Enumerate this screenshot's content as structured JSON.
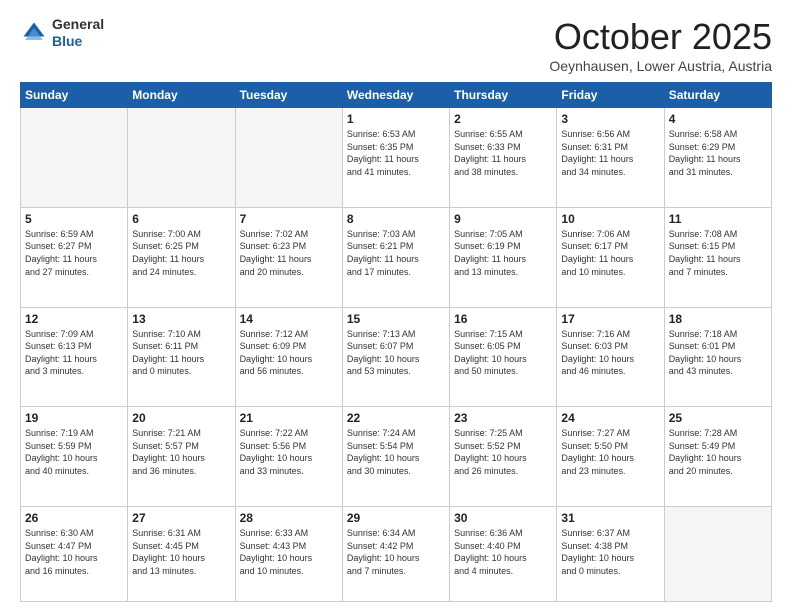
{
  "logo": {
    "line1": "General",
    "line2": "Blue"
  },
  "header": {
    "title": "October 2025",
    "subtitle": "Oeynhausen, Lower Austria, Austria"
  },
  "weekdays": [
    "Sunday",
    "Monday",
    "Tuesday",
    "Wednesday",
    "Thursday",
    "Friday",
    "Saturday"
  ],
  "weeks": [
    [
      {
        "day": "",
        "info": "",
        "empty": true
      },
      {
        "day": "",
        "info": "",
        "empty": true
      },
      {
        "day": "",
        "info": "",
        "empty": true
      },
      {
        "day": "1",
        "info": "Sunrise: 6:53 AM\nSunset: 6:35 PM\nDaylight: 11 hours\nand 41 minutes."
      },
      {
        "day": "2",
        "info": "Sunrise: 6:55 AM\nSunset: 6:33 PM\nDaylight: 11 hours\nand 38 minutes."
      },
      {
        "day": "3",
        "info": "Sunrise: 6:56 AM\nSunset: 6:31 PM\nDaylight: 11 hours\nand 34 minutes."
      },
      {
        "day": "4",
        "info": "Sunrise: 6:58 AM\nSunset: 6:29 PM\nDaylight: 11 hours\nand 31 minutes."
      }
    ],
    [
      {
        "day": "5",
        "info": "Sunrise: 6:59 AM\nSunset: 6:27 PM\nDaylight: 11 hours\nand 27 minutes."
      },
      {
        "day": "6",
        "info": "Sunrise: 7:00 AM\nSunset: 6:25 PM\nDaylight: 11 hours\nand 24 minutes."
      },
      {
        "day": "7",
        "info": "Sunrise: 7:02 AM\nSunset: 6:23 PM\nDaylight: 11 hours\nand 20 minutes."
      },
      {
        "day": "8",
        "info": "Sunrise: 7:03 AM\nSunset: 6:21 PM\nDaylight: 11 hours\nand 17 minutes."
      },
      {
        "day": "9",
        "info": "Sunrise: 7:05 AM\nSunset: 6:19 PM\nDaylight: 11 hours\nand 13 minutes."
      },
      {
        "day": "10",
        "info": "Sunrise: 7:06 AM\nSunset: 6:17 PM\nDaylight: 11 hours\nand 10 minutes."
      },
      {
        "day": "11",
        "info": "Sunrise: 7:08 AM\nSunset: 6:15 PM\nDaylight: 11 hours\nand 7 minutes."
      }
    ],
    [
      {
        "day": "12",
        "info": "Sunrise: 7:09 AM\nSunset: 6:13 PM\nDaylight: 11 hours\nand 3 minutes."
      },
      {
        "day": "13",
        "info": "Sunrise: 7:10 AM\nSunset: 6:11 PM\nDaylight: 11 hours\nand 0 minutes."
      },
      {
        "day": "14",
        "info": "Sunrise: 7:12 AM\nSunset: 6:09 PM\nDaylight: 10 hours\nand 56 minutes."
      },
      {
        "day": "15",
        "info": "Sunrise: 7:13 AM\nSunset: 6:07 PM\nDaylight: 10 hours\nand 53 minutes."
      },
      {
        "day": "16",
        "info": "Sunrise: 7:15 AM\nSunset: 6:05 PM\nDaylight: 10 hours\nand 50 minutes."
      },
      {
        "day": "17",
        "info": "Sunrise: 7:16 AM\nSunset: 6:03 PM\nDaylight: 10 hours\nand 46 minutes."
      },
      {
        "day": "18",
        "info": "Sunrise: 7:18 AM\nSunset: 6:01 PM\nDaylight: 10 hours\nand 43 minutes."
      }
    ],
    [
      {
        "day": "19",
        "info": "Sunrise: 7:19 AM\nSunset: 5:59 PM\nDaylight: 10 hours\nand 40 minutes."
      },
      {
        "day": "20",
        "info": "Sunrise: 7:21 AM\nSunset: 5:57 PM\nDaylight: 10 hours\nand 36 minutes."
      },
      {
        "day": "21",
        "info": "Sunrise: 7:22 AM\nSunset: 5:56 PM\nDaylight: 10 hours\nand 33 minutes."
      },
      {
        "day": "22",
        "info": "Sunrise: 7:24 AM\nSunset: 5:54 PM\nDaylight: 10 hours\nand 30 minutes."
      },
      {
        "day": "23",
        "info": "Sunrise: 7:25 AM\nSunset: 5:52 PM\nDaylight: 10 hours\nand 26 minutes."
      },
      {
        "day": "24",
        "info": "Sunrise: 7:27 AM\nSunset: 5:50 PM\nDaylight: 10 hours\nand 23 minutes."
      },
      {
        "day": "25",
        "info": "Sunrise: 7:28 AM\nSunset: 5:49 PM\nDaylight: 10 hours\nand 20 minutes."
      }
    ],
    [
      {
        "day": "26",
        "info": "Sunrise: 6:30 AM\nSunset: 4:47 PM\nDaylight: 10 hours\nand 16 minutes."
      },
      {
        "day": "27",
        "info": "Sunrise: 6:31 AM\nSunset: 4:45 PM\nDaylight: 10 hours\nand 13 minutes."
      },
      {
        "day": "28",
        "info": "Sunrise: 6:33 AM\nSunset: 4:43 PM\nDaylight: 10 hours\nand 10 minutes."
      },
      {
        "day": "29",
        "info": "Sunrise: 6:34 AM\nSunset: 4:42 PM\nDaylight: 10 hours\nand 7 minutes."
      },
      {
        "day": "30",
        "info": "Sunrise: 6:36 AM\nSunset: 4:40 PM\nDaylight: 10 hours\nand 4 minutes."
      },
      {
        "day": "31",
        "info": "Sunrise: 6:37 AM\nSunset: 4:38 PM\nDaylight: 10 hours\nand 0 minutes."
      },
      {
        "day": "",
        "info": "",
        "empty": true
      }
    ]
  ]
}
